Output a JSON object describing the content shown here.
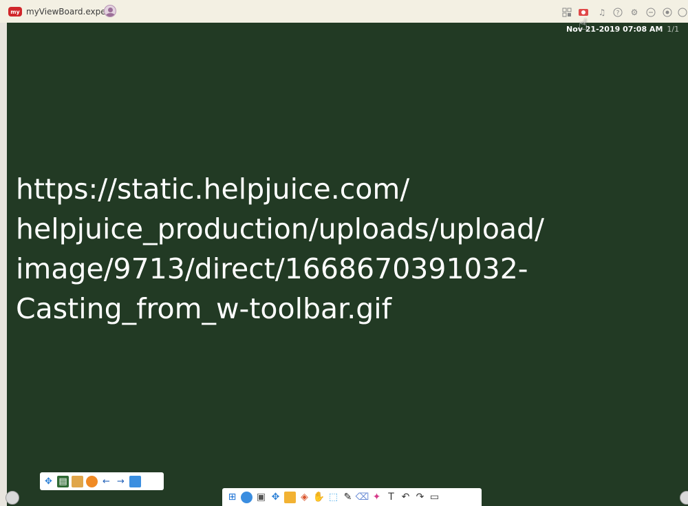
{
  "window": {
    "title": "myViewBoard.expert",
    "logo_text": "my"
  },
  "board": {
    "timestamp": "Nov 21-2019 07:08 AM",
    "page_count": "1/1",
    "url_lines": [
      "https://static.helpjuice.com/",
      "helpjuice_production/uploads/upload/",
      "image/9713/direct/1668670391032-",
      "Casting_from_w-toolbar.gif"
    ]
  },
  "top_icons": [
    "qr-grid-icon",
    "cast-icon",
    "bell-icon",
    "help-icon",
    "settings-icon",
    "minimize-icon",
    "record-icon",
    "close-icon"
  ],
  "colors": {
    "board": "#223a24",
    "topbar": "#f3f0e3",
    "logo": "#d0262a"
  }
}
